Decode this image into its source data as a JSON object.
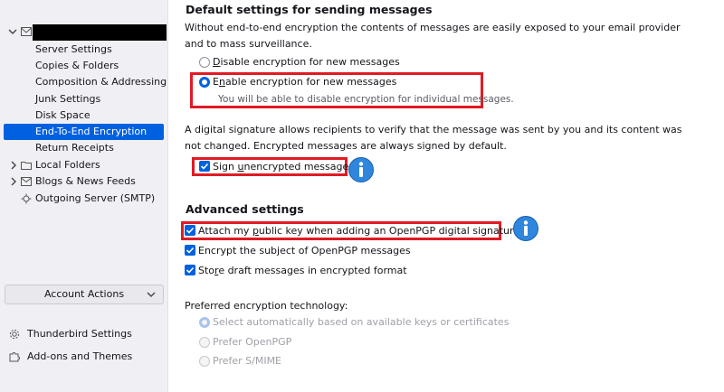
{
  "sidebar": {
    "account_settings": [
      {
        "label": "Server Settings",
        "selected": false
      },
      {
        "label": "Copies & Folders",
        "selected": false
      },
      {
        "label": "Composition & Addressing",
        "selected": false
      },
      {
        "label": "Junk Settings",
        "selected": false
      },
      {
        "label": "Disk Space",
        "selected": false
      },
      {
        "label": "End-To-End Encryption",
        "selected": true
      },
      {
        "label": "Return Receipts",
        "selected": false
      }
    ],
    "folders": [
      {
        "label": "Local Folders",
        "icon": "folder-icon"
      },
      {
        "label": "Blogs & News Feeds",
        "icon": "feed-icon"
      },
      {
        "label": "Outgoing Server (SMTP)",
        "icon": "server-icon"
      }
    ],
    "account_actions": "Account Actions",
    "thunderbird_settings": "Thunderbird Settings",
    "addons_and_themes": "Add-ons and Themes"
  },
  "main": {
    "default_heading": "Default settings for sending messages",
    "default_desc_line1": "Without end-to-end encryption the contents of messages are easily exposed to your email provider",
    "default_desc_line2": "and to mass surveillance.",
    "radio_disable_pre": "",
    "radio_disable_key": "D",
    "radio_disable_post": "isable encryption for new messages",
    "radio_enable_pre": "E",
    "radio_enable_key": "n",
    "radio_enable_post": "able encryption for new messages",
    "radio_enable_hint": "You will be able to disable encryption for individual messages.",
    "signature_desc_line1": "A digital signature allows recipients to verify that the message was sent by you and its content was",
    "signature_desc_line2": "not changed. Encrypted messages are always signed by default.",
    "sign_pre": "Sign ",
    "sign_key": "u",
    "sign_post": "nencrypted messages",
    "advanced_heading": "Advanced settings",
    "attach_pre": "Attach my ",
    "attach_key": "p",
    "attach_post": "ublic key when adding an OpenPGP digital signature",
    "subject_pre": "Encrypt the sub",
    "subject_key": "j",
    "subject_post": "ect of OpenPGP messages",
    "draft_pre": "Sto",
    "draft_key": "r",
    "draft_post": "e draft messages in encrypted format",
    "tech_label": "Preferred encryption technology:",
    "tech_auto": "Select automatically based on available keys or certificates",
    "tech_openpgp": "Prefer OpenPGP",
    "tech_smime": "Prefer S/MIME"
  },
  "colors": {
    "accent": "#0061e0",
    "highlight_box": "#e01b24",
    "sidebar_bg": "#f0f0f4"
  }
}
